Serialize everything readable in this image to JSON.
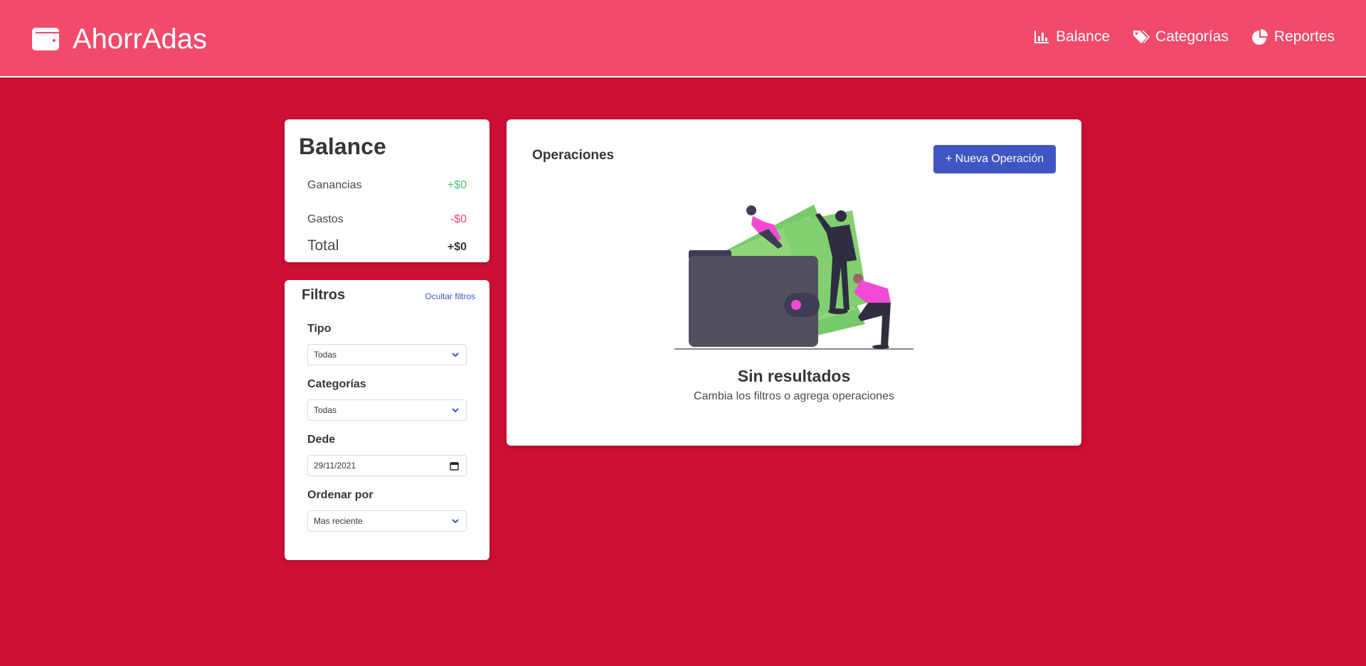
{
  "header": {
    "brand": "AhorrAdas",
    "brand_icon": "wallet-icon",
    "nav": [
      {
        "label": "Balance",
        "icon": "chart-bar-icon"
      },
      {
        "label": "Categorías",
        "icon": "tags-icon"
      },
      {
        "label": "Reportes",
        "icon": "chart-pie-icon"
      }
    ]
  },
  "balance": {
    "title": "Balance",
    "rows": [
      {
        "label": "Ganancias",
        "value": "+$0"
      },
      {
        "label": "Gastos",
        "value": "-$0"
      },
      {
        "label": "Total",
        "value": "+$0"
      }
    ]
  },
  "filters": {
    "title": "Filtros",
    "hide_link": "Ocultar filtros",
    "fields": [
      {
        "label": "Tipo",
        "value": "Todas"
      },
      {
        "label": "Categorías",
        "value": "Todas"
      },
      {
        "label": "Dede",
        "value": "29/11/2021"
      },
      {
        "label": "Ordenar por",
        "value": "Mas reciente"
      }
    ]
  },
  "operations": {
    "title": "Operaciones",
    "new_button": "+ Nueva Operación",
    "empty_title": "Sin resultados",
    "empty_subtitle": "Cambia los filtros o agrega operaciones"
  },
  "colors": {
    "navbar": "#f24a6b",
    "background": "#cc0f33",
    "primary": "#3e56c4",
    "positive": "#48c774",
    "negative": "#f14668"
  }
}
